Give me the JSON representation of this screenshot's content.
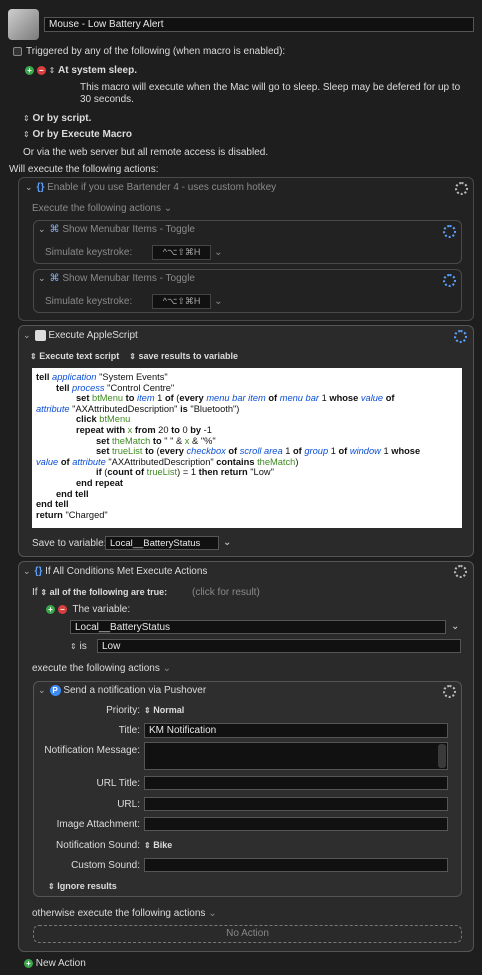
{
  "macro": {
    "name": "Mouse - Low Battery Alert"
  },
  "triggers": {
    "header": "Triggered by any of the following (when macro is enabled):",
    "sleep_label": "At system sleep.",
    "sleep_desc_1": "This macro will execute when the Mac will go to sleep.  Sleep may be defered for up to",
    "sleep_desc_2": "30 seconds.",
    "or_script": "Or by script.",
    "or_execute": "Or by Execute Macro",
    "web_server": "Or via the web server but all remote access is disabled."
  },
  "actions_header": "Will execute the following actions:",
  "group1": {
    "title": "Enable if you use Bartender 4 - uses custom hotkey",
    "sub": "Execute the following actions",
    "item_title": "Show Menubar Items - Toggle",
    "keystroke_label": "Simulate keystroke:",
    "keystroke": "^⌥⇧⌘H"
  },
  "applescript": {
    "title": "Execute AppleScript",
    "mode": "Execute text script",
    "save_mode": "save results to variable",
    "save_label": "Save to variable:",
    "save_var": "Local__BatteryStatus",
    "line1a": "tell",
    "line1b": "application",
    "line1c": "\"System Events\"",
    "line2a": "tell",
    "line2b": "process",
    "line2c": "\"Control Centre\"",
    "line3": "set btMenu to item 1 of (every menu bar item of menu bar 1 whose value of",
    "line4": "attribute \"AXAttributedDescription\" is \"Bluetooth\")",
    "line5": "click btMenu",
    "line6": "repeat with x from 20 to 0 by -1",
    "line7": "set theMatch to \" \" & x & \"%\"",
    "line8": "set trueList to (every checkbox of scroll area 1 of group 1 of window 1 whose",
    "line9": "value of attribute \"AXAttributedDescription\" contains theMatch)",
    "line10": "if (count of trueList) = 1 then return \"Low\"",
    "line11": "end repeat",
    "line12": "end tell",
    "line13": "end tell",
    "line14": "return \"Charged\""
  },
  "ifblock": {
    "title": "If All Conditions Met Execute Actions",
    "if_label": "If",
    "cond_mode": "all of the following are true:",
    "click_result": "(click for result)",
    "the_variable": "The variable:",
    "var_name": "Local__BatteryStatus",
    "op": "is",
    "value": "Low",
    "exec_label": "execute the following actions",
    "otherwise": "otherwise execute the following actions",
    "no_action": "No Action"
  },
  "pushover": {
    "title": "Send a notification via Pushover",
    "priority_label": "Priority:",
    "priority": "Normal",
    "title_label": "Title:",
    "title_value": "KM Notification",
    "msg_label": "Notification Message:",
    "url_title_label": "URL Title:",
    "url_label": "URL:",
    "image_label": "Image Attachment:",
    "sound_label": "Notification Sound:",
    "sound": "Bike",
    "custom_label": "Custom Sound:",
    "ignore": "Ignore results"
  },
  "footer": {
    "new_action": "New Action"
  },
  "colors": {
    "accent": "#5aa0ff",
    "plus": "#3aa84a",
    "minus": "#d84040"
  }
}
